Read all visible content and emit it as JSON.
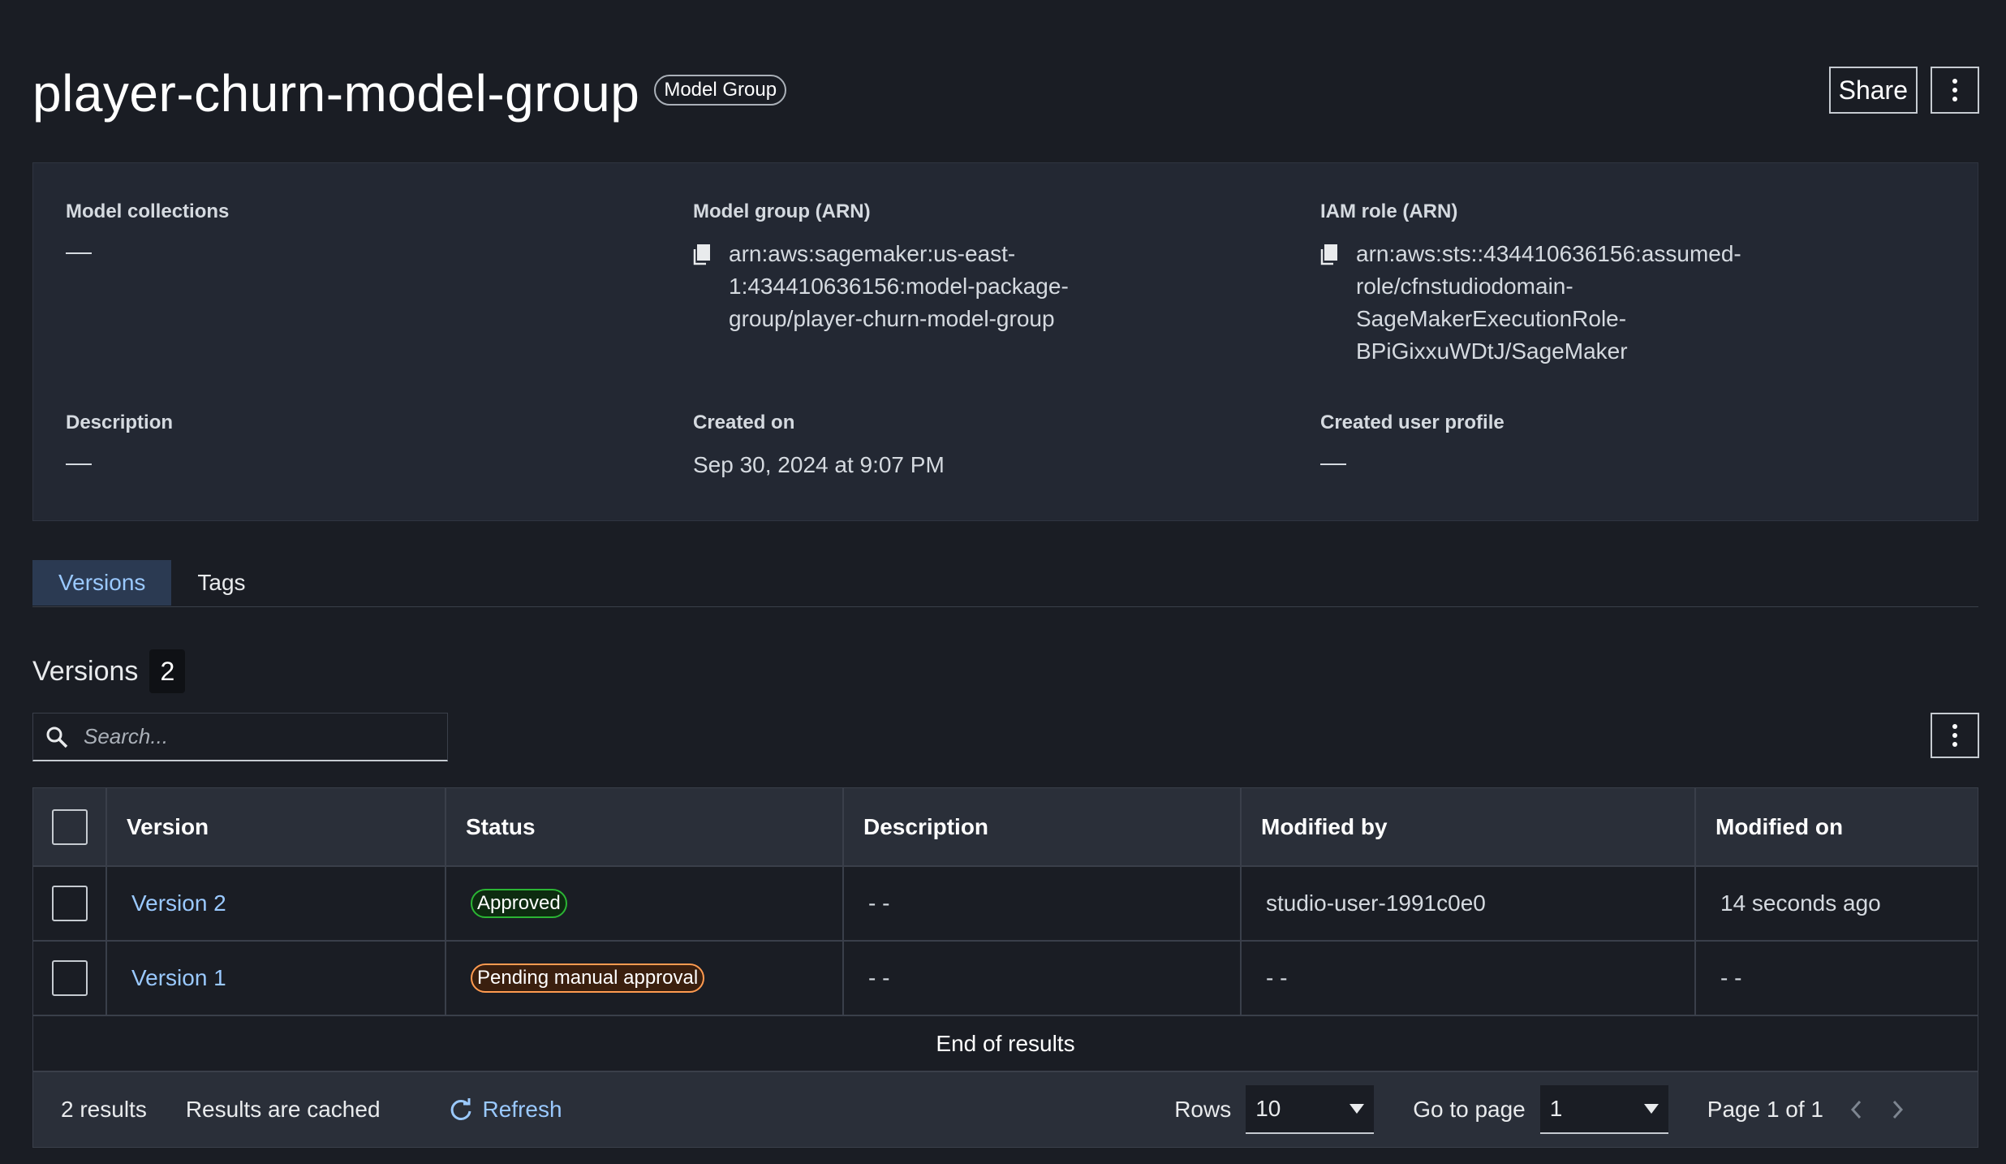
{
  "header": {
    "title": "player-churn-model-group",
    "type_badge": "Model Group",
    "share_label": "Share"
  },
  "details": {
    "model_collections": {
      "label": "Model collections",
      "value": "—"
    },
    "model_group_arn": {
      "label": "Model group (ARN)",
      "lines": [
        "arn:aws:sagemaker:us-east-",
        "1:434410636156:model-package-",
        "group/player-churn-model-group"
      ]
    },
    "iam_role_arn": {
      "label": "IAM role (ARN)",
      "lines": [
        "arn:aws:sts::434410636156:assumed-",
        "role/cfnstudiodomain-",
        "SageMakerExecutionRole-",
        "BPiGixxuWDtJ/SageMaker"
      ]
    },
    "description": {
      "label": "Description",
      "value": "—"
    },
    "created_on": {
      "label": "Created on",
      "value": "Sep 30, 2024 at 9:07 PM"
    },
    "created_user_profile": {
      "label": "Created user profile",
      "value": "—"
    }
  },
  "tabs": [
    {
      "label": "Versions",
      "active": true
    },
    {
      "label": "Tags",
      "active": false
    }
  ],
  "versions": {
    "title": "Versions",
    "count": "2",
    "search_placeholder": "Search..."
  },
  "table": {
    "columns": [
      "Version",
      "Status",
      "Description",
      "Modified by",
      "Modified on"
    ],
    "rows": [
      {
        "version": "Version 2",
        "status": "Approved",
        "status_kind": "approved",
        "description": "- -",
        "modified_by": "studio-user-1991c0e0",
        "modified_on": "14 seconds ago"
      },
      {
        "version": "Version 1",
        "status": "Pending manual approval",
        "status_kind": "pending",
        "description": "- -",
        "modified_by": "- -",
        "modified_on": "- -"
      }
    ],
    "end_text": "End of results"
  },
  "footer": {
    "results": "2 results",
    "cached": "Results are cached",
    "refresh_label": "Refresh",
    "rows_label": "Rows",
    "rows_value": "10",
    "goto_label": "Go to page",
    "goto_value": "1",
    "page_info": "Page 1 of 1"
  },
  "colors": {
    "background": "#1a1d24",
    "panel": "#232833",
    "link": "#9ac9ff",
    "approved": "#2bb534",
    "pending": "#ff9b50"
  }
}
